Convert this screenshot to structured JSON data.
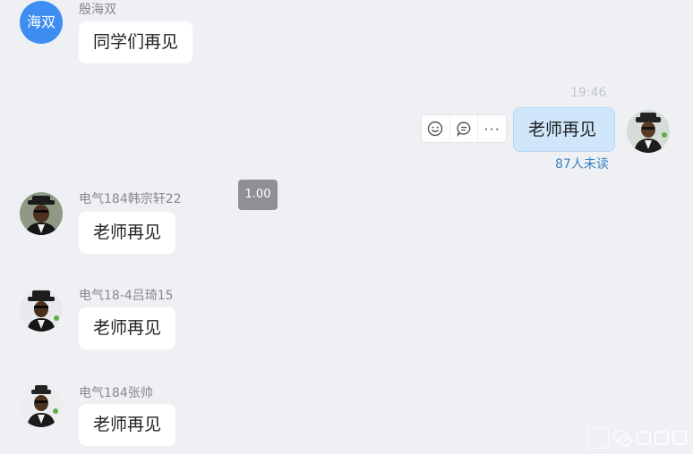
{
  "messages": [
    {
      "sender": "殷海双",
      "avatar_text": "海双",
      "text": "同学们再见"
    },
    {
      "sender": "电气184韩宗轩22",
      "text": "老师再见"
    },
    {
      "sender": "电气18-4吕琦15",
      "text": "老师再见"
    },
    {
      "sender": "电气184张帅",
      "text": "老师再见"
    }
  ],
  "self_message": {
    "timestamp": "19:46",
    "text": "老师再见",
    "unread": "87人未读"
  },
  "toolbar": {
    "icons": [
      "emoji-icon",
      "comment-icon",
      "more-icon"
    ],
    "more_label": "···"
  },
  "speed_badge": "1.00",
  "colors": {
    "background": "#eef0f4",
    "self_bubble": "#cfe6fb",
    "unread": "#3b82c4",
    "avatar_blue": "#3d8ef0"
  }
}
